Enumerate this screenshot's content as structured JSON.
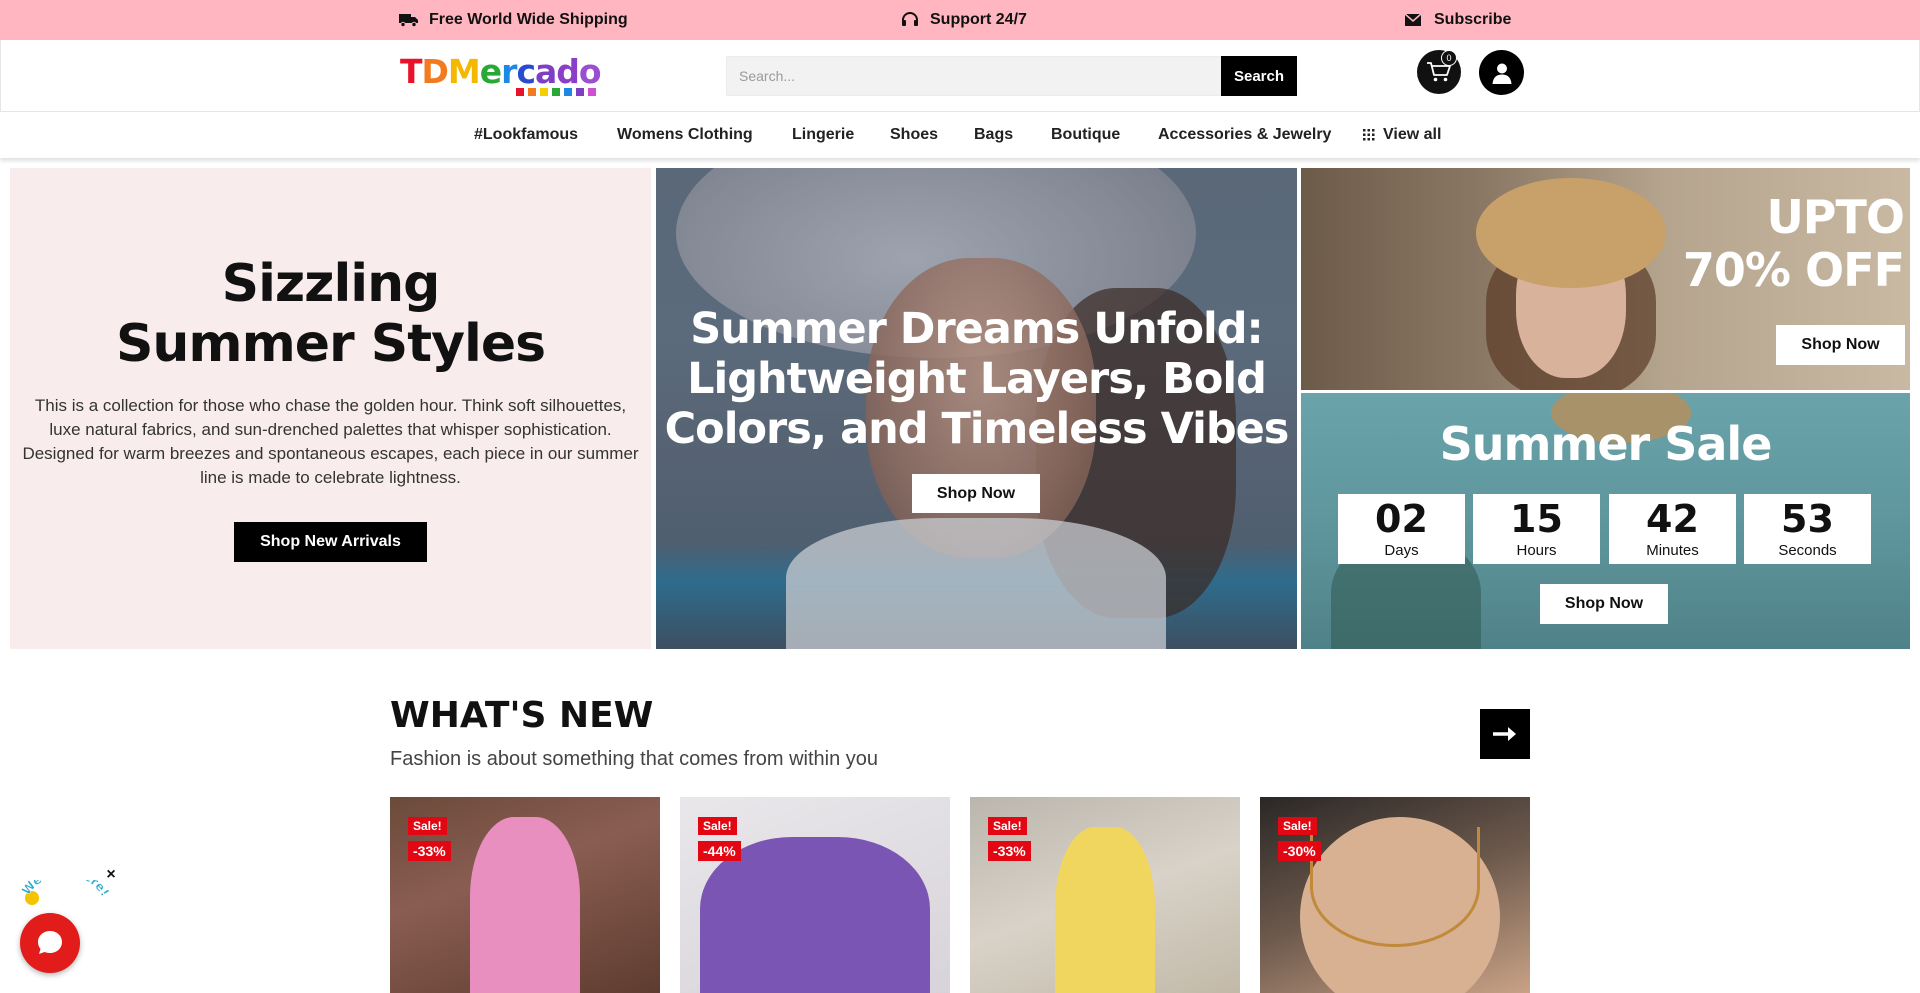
{
  "topbar": {
    "shipping": "Free World Wide Shipping",
    "support": "Support 24/7",
    "subscribe": "Subscribe",
    "icons": [
      "truck-icon",
      "headset-icon",
      "envelope-icon"
    ],
    "background": "#ffb6c1"
  },
  "header": {
    "logo_text": "TDMercado",
    "search_placeholder": "Search...",
    "search_button": "Search",
    "cart_count": "0"
  },
  "nav": {
    "items": [
      {
        "label": "#Lookfamous"
      },
      {
        "label": "Womens Clothing"
      },
      {
        "label": "Lingerie"
      },
      {
        "label": "Shoes"
      },
      {
        "label": "Bags"
      },
      {
        "label": "Boutique"
      },
      {
        "label": "Accessories & Jewelry"
      },
      {
        "label": "View all"
      }
    ]
  },
  "hero": {
    "left": {
      "title_line1": "Sizzling",
      "title_line2": "Summer Styles",
      "description": "This is a collection for those who chase the golden hour. Think soft silhouettes, luxe natural fabrics, and sun-drenched palettes that whisper sophistication. Designed for warm breezes and spontaneous escapes, each piece in our summer line is made to celebrate lightness.",
      "button": "Shop New Arrivals"
    },
    "middle": {
      "title_line1": "Summer Dreams Unfold:",
      "title_line2": "Lightweight Layers, Bold",
      "title_line3": "Colors, and Timeless Vibes",
      "button": "Shop Now"
    },
    "right_top": {
      "title_line1": "UPTO",
      "title_line2": "70% OFF",
      "button": "Shop Now"
    },
    "right_bottom": {
      "title": "Summer Sale",
      "countdown": [
        {
          "value": "02",
          "label": "Days"
        },
        {
          "value": "15",
          "label": "Hours"
        },
        {
          "value": "42",
          "label": "Minutes"
        },
        {
          "value": "53",
          "label": "Seconds"
        }
      ],
      "button": "Shop Now"
    }
  },
  "whats_new": {
    "title": "WHAT'S NEW",
    "subtitle": "Fashion is about something that comes from within you",
    "products": [
      {
        "badge": "Sale!",
        "discount": "-33%"
      },
      {
        "badge": "Sale!",
        "discount": "-44%"
      },
      {
        "badge": "Sale!",
        "discount": "-33%"
      },
      {
        "badge": "Sale!",
        "discount": "-30%"
      }
    ]
  },
  "chat": {
    "close": "×",
    "badge_text": "We Are Here!"
  },
  "colors": {
    "accent_black": "#000000",
    "sale_red": "#e30613",
    "chat_red": "#e21b1b",
    "hero_left_bg": "#f9ecec"
  }
}
